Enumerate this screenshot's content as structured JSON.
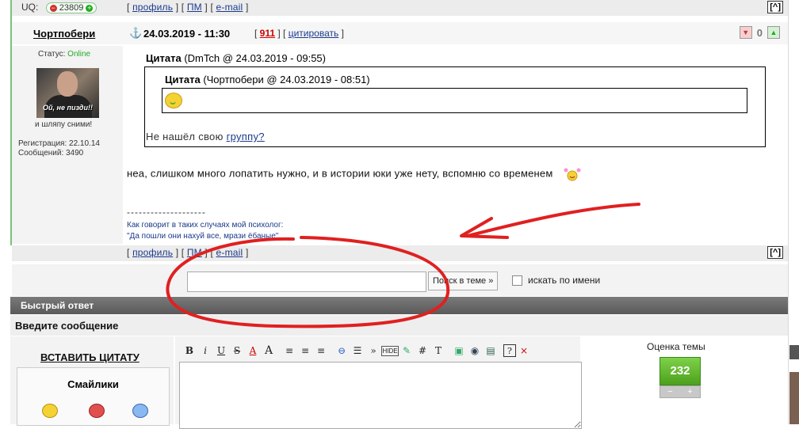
{
  "top_bar": {
    "uq_label": "UQ:",
    "uq_value": "23809",
    "links": [
      "профиль",
      "ПМ",
      "e-mail"
    ],
    "top_button": "[^]"
  },
  "post": {
    "author": "Чортпобери",
    "datetime": "24.03.2019 - 11:30",
    "post_number": "911",
    "quote_link": "цитировать",
    "votes": "0",
    "user": {
      "status_label": "Статус:",
      "status_value": "Online",
      "avatar_caption_1": "Ой, не пизди!!",
      "avatar_caption_2": "и шляпу сними!",
      "registration": "Регистрация: 22.10.14",
      "messages": "Сообщений: 3490"
    },
    "quote_outer": {
      "title": "Цитата",
      "meta": "(DmTch @ 24.03.2019 - 09:55)",
      "text": "Не нашёл свою",
      "link": "группу?"
    },
    "quote_inner": {
      "title": "Цитата",
      "meta": "(Чортпобери @ 24.03.2019 - 08:51)"
    },
    "message": "неа, слишком много лопатить нужно, и в истории юки уже нету, вспомню со временем",
    "signature_line": "--------------------",
    "signature_1": "Как говорит в таких случаях мой психолог:",
    "signature_2": "\"Да пошли они нахуй все, мрази ёбаные\""
  },
  "bottom_bar": {
    "links": [
      "профиль",
      "ПМ",
      "e-mail"
    ],
    "top_button": "[^]"
  },
  "search": {
    "input_value": "",
    "button_label": "Поиск в теме »",
    "checkbox_label": "искать по имени",
    "checked": false
  },
  "quick_reply": {
    "header": "Быстрый ответ",
    "subheader": "Введите сообщение",
    "insert_quote": "ВСТАВИТЬ ЦИТАТУ",
    "smilies_title": "Смайлики",
    "toolbar": [
      "B",
      "i",
      "U",
      "S",
      "A",
      "A",
      "≡",
      "≡",
      "≡",
      "link",
      "list",
      "»",
      "HIDE",
      "edit",
      "#",
      "T",
      "img",
      "flash",
      "video",
      "?",
      "×"
    ],
    "rating_title": "Оценка темы",
    "rating_value": "232"
  },
  "colors": {
    "accent_green": "#4ca01c",
    "link_blue": "#1a3a8a",
    "annotation_red": "#e02020"
  }
}
